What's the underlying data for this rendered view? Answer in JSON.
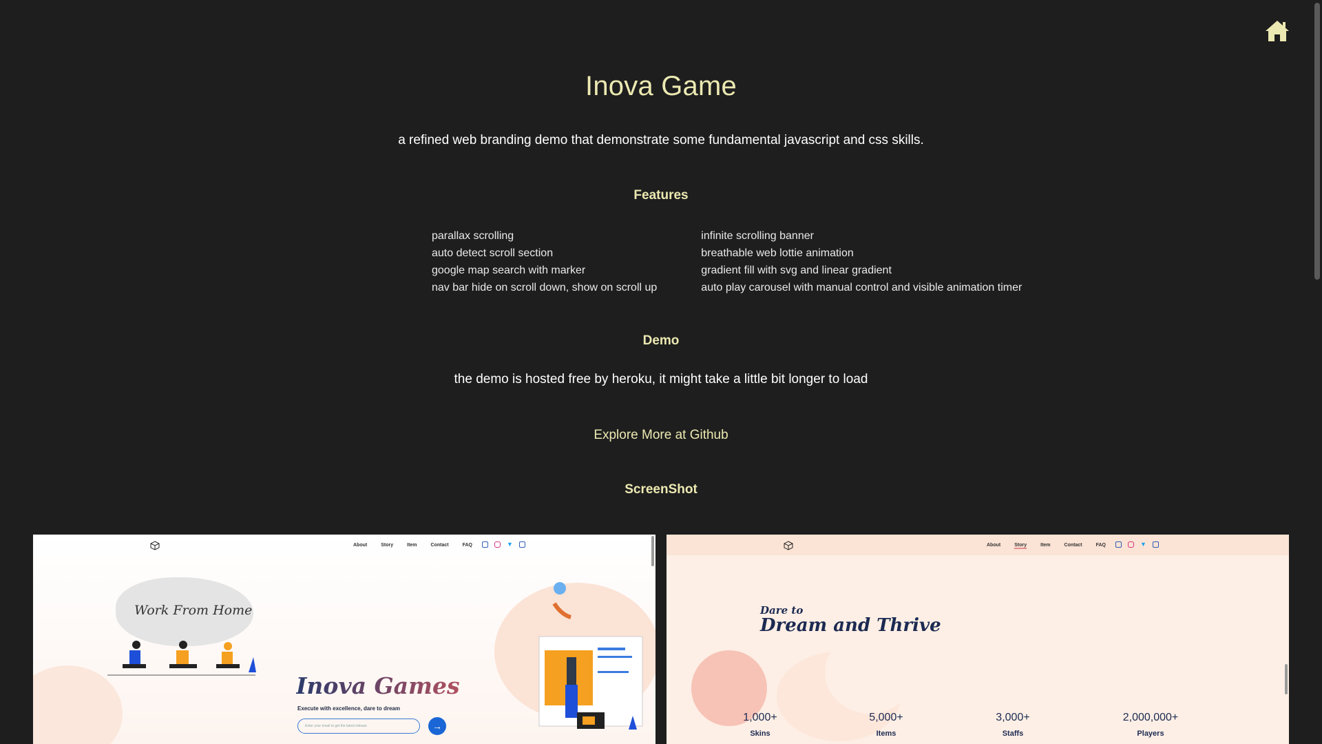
{
  "header": {
    "home_icon": "home-icon",
    "title": "Inova Game",
    "subtitle": "a refined web branding demo that demonstrate some fundamental javascript and css skills."
  },
  "features": {
    "heading": "Features",
    "left": [
      "parallax scrolling",
      "auto detect scroll section",
      "google map search with marker",
      "nav bar hide on scroll down, show on scroll up"
    ],
    "right": [
      "infinite scrolling banner",
      "breathable web lottie animation",
      "gradient fill with svg and linear gradient",
      "auto play carousel with manual control and visible animation timer"
    ]
  },
  "demo": {
    "heading": "Demo",
    "note": "the demo is hosted free by heroku, it might take a little bit longer to load"
  },
  "github_link": "Explore More at Github",
  "screenshot": {
    "heading": "ScreenShot",
    "nav_links": [
      "About",
      "Story",
      "Item",
      "Contact",
      "FAQ"
    ],
    "shot1": {
      "wfh_text": "Work From Home",
      "brand": "Inova Games",
      "tagline": "Execute with excellence, dare to dream",
      "email_placeholder": "Enter your email to get the latest release"
    },
    "shot2": {
      "kicker": "Dare to",
      "headline": "Dream and Thrive",
      "stats": [
        {
          "value": "1,000+",
          "label": "Skins"
        },
        {
          "value": "5,000+",
          "label": "Items"
        },
        {
          "value": "3,000+",
          "label": "Staffs"
        },
        {
          "value": "2,000,000+",
          "label": "Players"
        }
      ]
    }
  },
  "colors": {
    "background": "#1e1e1e",
    "accent": "#ece9b2",
    "text": "#ffffff"
  }
}
